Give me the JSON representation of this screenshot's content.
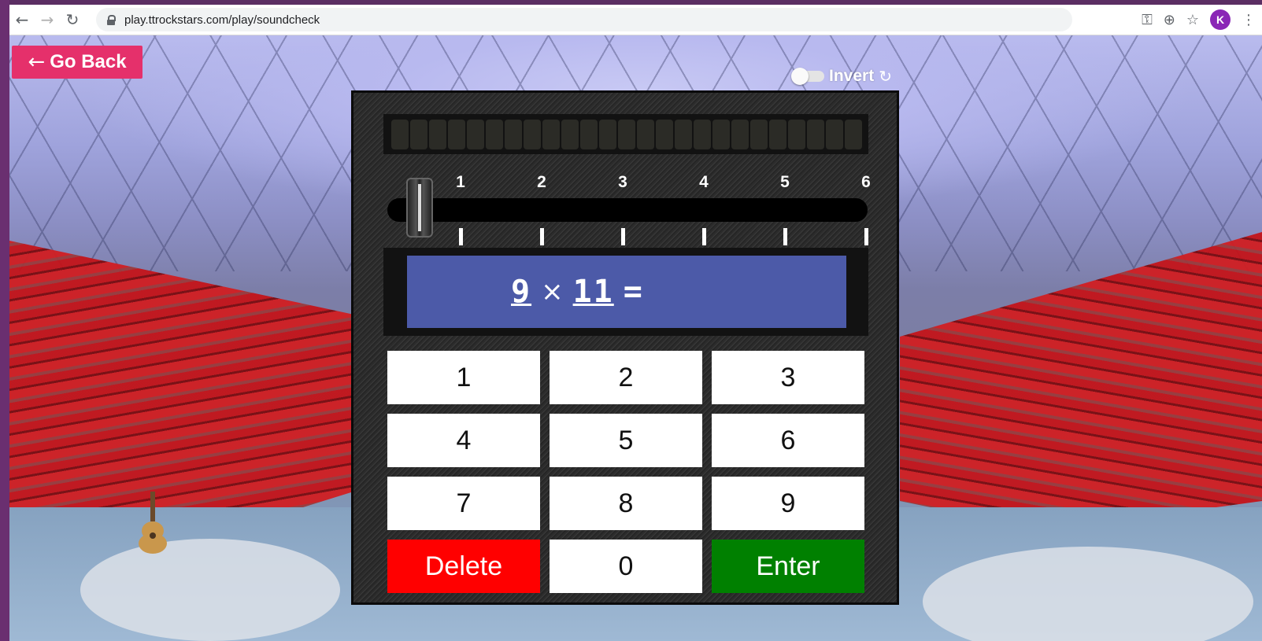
{
  "browser": {
    "url": "play.ttrockstars.com/play/soundcheck",
    "profile_initial": "K",
    "icons": [
      "back-arrow-icon",
      "forward-arrow-icon",
      "reload-icon",
      "lock-icon",
      "key-icon",
      "add-icon",
      "star-icon",
      "menu-icon"
    ]
  },
  "page": {
    "go_back_label": "Go Back",
    "invert_label": "Invert",
    "invert_on": false,
    "accent_color": "#e5306b"
  },
  "game": {
    "meter_cells_total": 25,
    "meter_cells_lit": 0,
    "speed_scale": [
      "1",
      "2",
      "3",
      "4",
      "5",
      "6"
    ],
    "speed_level": 0,
    "question": {
      "left": "9",
      "operator": "×",
      "right": "11",
      "equals": "="
    },
    "keys": [
      "1",
      "2",
      "3",
      "4",
      "5",
      "6",
      "7",
      "8",
      "9",
      "Delete",
      "0",
      "Enter"
    ],
    "colors": {
      "delete": "#ff0000",
      "enter": "#008000",
      "question_bg": "#4c5aa8"
    }
  }
}
